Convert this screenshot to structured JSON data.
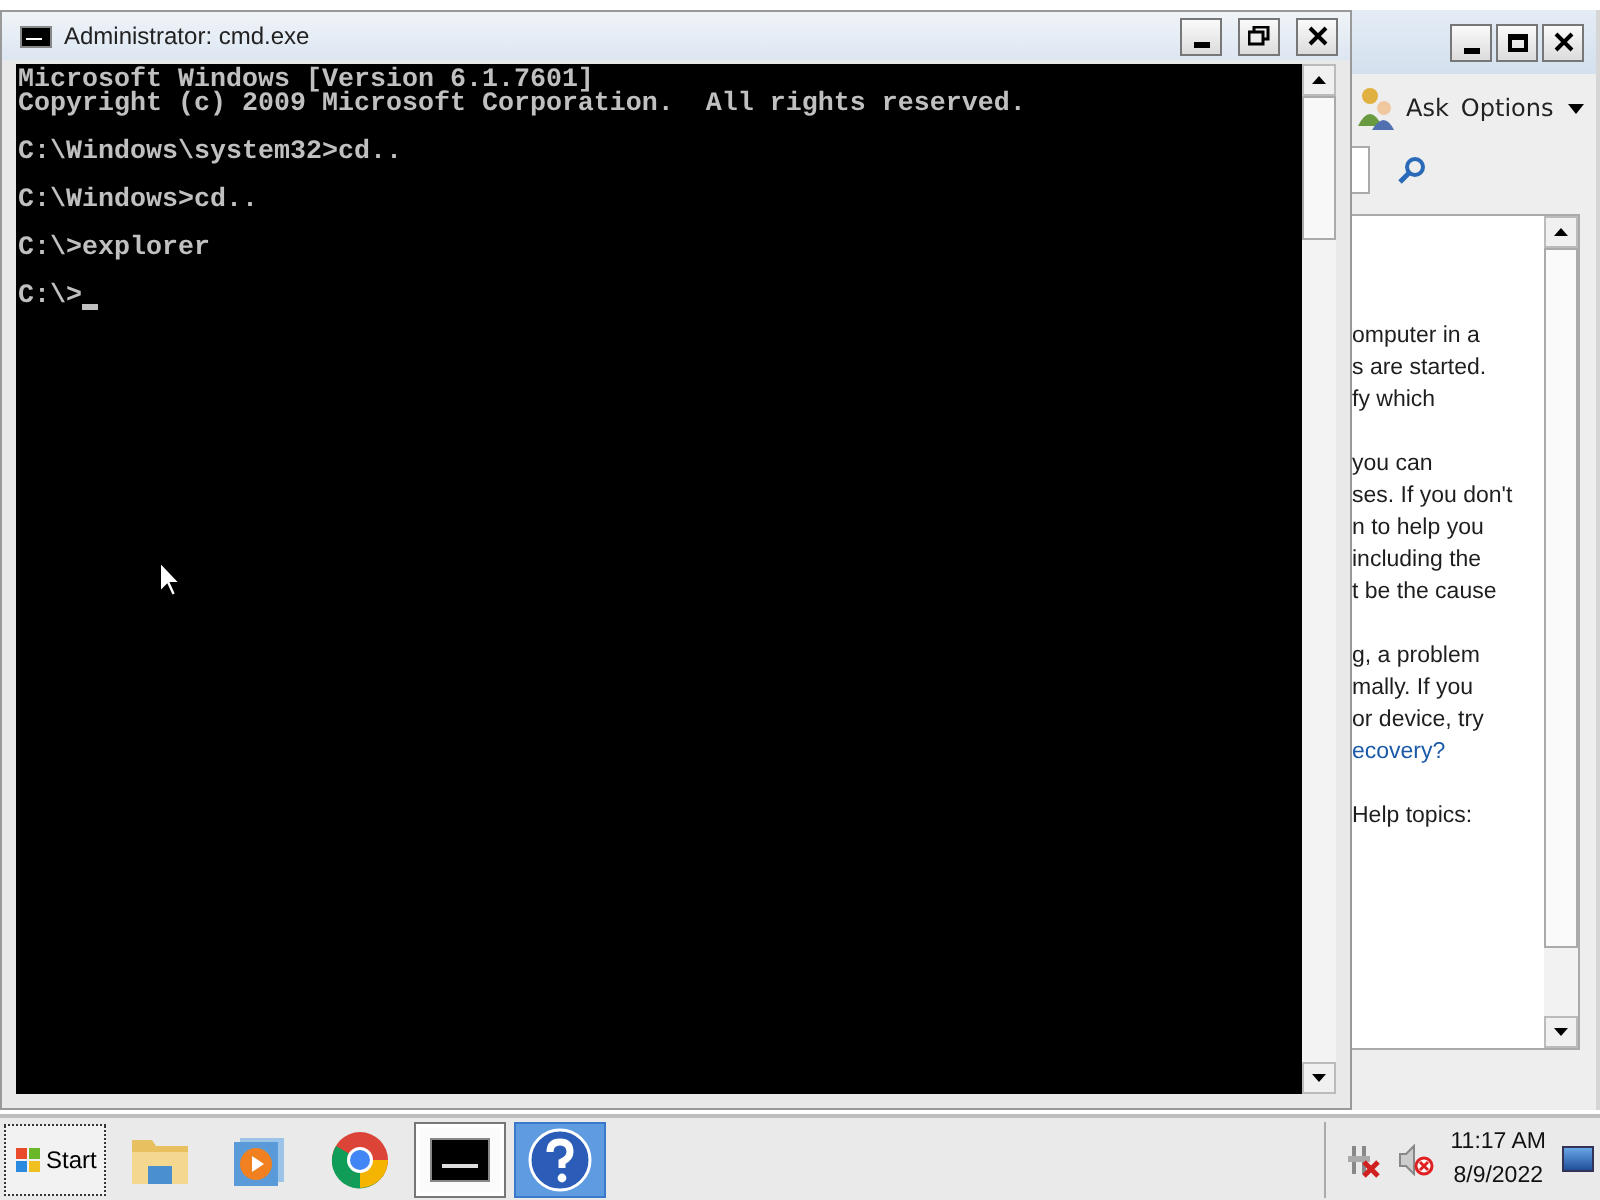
{
  "cmd_window": {
    "title": "Administrator: cmd.exe",
    "console_blocks": [
      [
        "Microsoft Windows [Version 6.1.7601]",
        "Copyright (c) 2009 Microsoft Corporation.  All rights reserved."
      ],
      [
        "C:\\Windows\\system32>cd.."
      ],
      [
        "C:\\Windows>cd.."
      ],
      [
        "C:\\>explorer"
      ],
      [
        "C:\\>"
      ]
    ]
  },
  "help_window": {
    "toolbar": [
      {
        "label": "Ask",
        "kind": "button"
      },
      {
        "label": "Options",
        "kind": "menu"
      }
    ],
    "paragraphs": [
      {
        "lines": [
          {
            "text": "omputer in a",
            "kind": "text"
          },
          {
            "text": "s are started.",
            "kind": "text"
          },
          {
            "text": "fy which",
            "kind": "text"
          }
        ]
      },
      {
        "lines": [
          {
            "text": "you can",
            "kind": "text"
          },
          {
            "text": "ses. If you don't",
            "kind": "text"
          },
          {
            "text": "n to help you",
            "kind": "text"
          },
          {
            "text": "including the",
            "kind": "text"
          },
          {
            "text": "t be the cause",
            "kind": "text"
          }
        ]
      },
      {
        "lines": [
          {
            "text": "g, a problem",
            "kind": "text"
          },
          {
            "text": "mally. If you",
            "kind": "text"
          },
          {
            "text": "or device, try",
            "kind": "text"
          },
          {
            "text": "ecovery?",
            "kind": "link"
          }
        ]
      },
      {
        "lines": [
          {
            "text": "Help topics:",
            "kind": "text"
          }
        ]
      }
    ]
  },
  "taskbar": {
    "start": "Start",
    "items": [
      {
        "kind": "folder",
        "selected": false,
        "hovered": false
      },
      {
        "kind": "player",
        "selected": false,
        "hovered": false
      },
      {
        "kind": "browser",
        "selected": false,
        "hovered": false
      },
      {
        "kind": "console",
        "selected": true,
        "hovered": false
      },
      {
        "kind": "help",
        "selected": false,
        "hovered": true
      }
    ],
    "clock": {
      "time": "11:17 AM",
      "date": "8/9/2022"
    }
  }
}
